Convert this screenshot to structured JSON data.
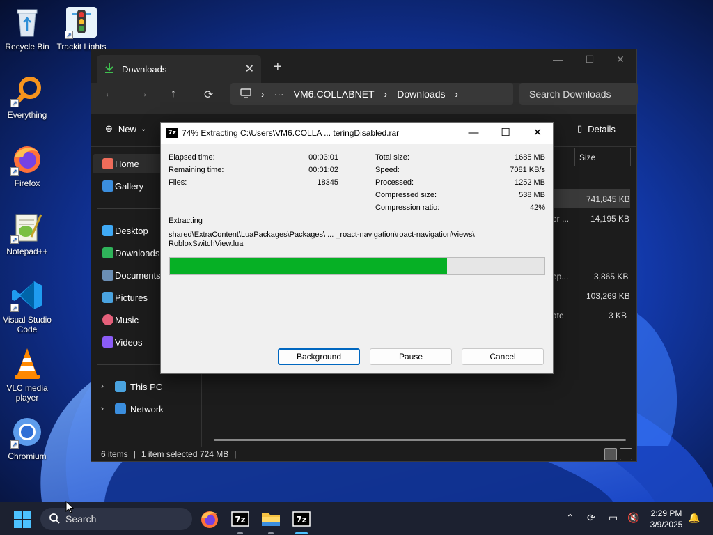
{
  "desktop": {
    "icons": [
      {
        "label": "Recycle Bin"
      },
      {
        "label": "Trackit Lights"
      },
      {
        "label": "Everything"
      },
      {
        "label": "Firefox"
      },
      {
        "label": "Notepad++"
      },
      {
        "label": "Visual Studio Code"
      },
      {
        "label": "VLC media player"
      },
      {
        "label": "Chromium"
      }
    ]
  },
  "explorer": {
    "tab_title": "Downloads",
    "address": {
      "segments": [
        "VM6.COLLABNET",
        "Downloads"
      ],
      "ellipsis": "···"
    },
    "search_placeholder": "Search Downloads",
    "new_label": "New",
    "details_label": "Details",
    "sidebar": {
      "home": "Home",
      "gallery": "Gallery",
      "desktop": "Desktop",
      "downloads": "Downloads",
      "documents": "Documents",
      "pictures": "Pictures",
      "music": "Music",
      "videos": "Videos",
      "this_pc": "This PC",
      "network": "Network"
    },
    "column_size": "Size",
    "rows": [
      {
        "partial": "",
        "size": "741,845 KB"
      },
      {
        "partial": "er ...",
        "size": "14,195 KB"
      },
      {
        "partial": "op...",
        "size": "3,865 KB"
      },
      {
        "partial": "",
        "size": "103,269 KB"
      },
      {
        "partial": "ate",
        "size": "3 KB"
      }
    ],
    "status": {
      "items": "6 items",
      "selected": "1 item selected  724 MB"
    }
  },
  "dialog": {
    "title": "74% Extracting C:\\Users\\VM6.COLLA ... teringDisabled.rar",
    "icon_text": "7z",
    "left_stats": [
      {
        "label": "Elapsed time:",
        "value": "00:03:01"
      },
      {
        "label": "Remaining time:",
        "value": "00:01:02"
      },
      {
        "label": "Files:",
        "value": "18345"
      }
    ],
    "right_stats": [
      {
        "label": "Total size:",
        "value": "1685 MB"
      },
      {
        "label": "Speed:",
        "value": "7081 KB/s"
      },
      {
        "label": "Processed:",
        "value": "1252 MB"
      },
      {
        "label": "Compressed size:",
        "value": "538 MB"
      },
      {
        "label": "Compression ratio:",
        "value": "42%"
      }
    ],
    "operation": "Extracting",
    "path_line1": "shared\\ExtraContent\\LuaPackages\\Packages\\ ... _roact-navigation\\roact-navigation\\views\\",
    "path_line2": "RobloxSwitchView.lua",
    "progress_percent": 74,
    "progress_color": "#06b025",
    "buttons": {
      "background": "Background",
      "pause": "Pause",
      "cancel": "Cancel"
    }
  },
  "taskbar": {
    "search_placeholder": "Search",
    "clock_time": "2:29 PM",
    "clock_date": "3/9/2025"
  }
}
